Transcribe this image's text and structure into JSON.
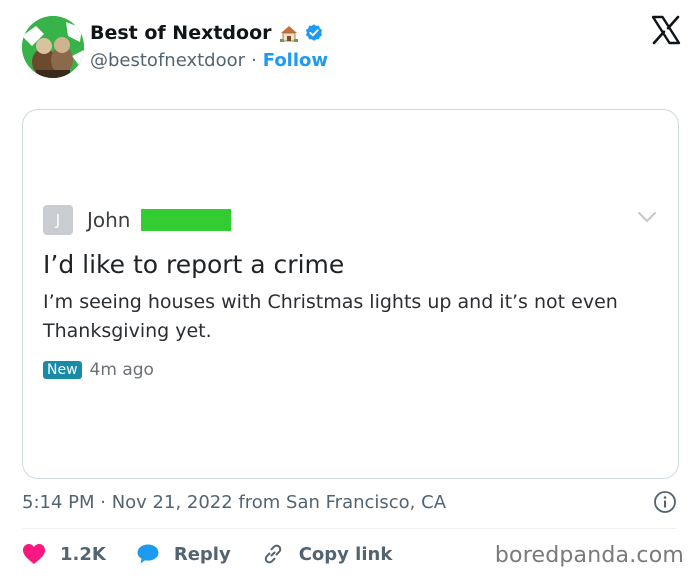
{
  "tweet": {
    "display_name": "Best of Nextdoor",
    "handle": "@bestofnextdoor",
    "separator": "·",
    "follow_label": "Follow",
    "timestamp": "5:14 PM · Nov 21, 2022 from San Francisco, CA",
    "likes_count": "1.2K",
    "reply_label": "Reply",
    "copy_link_label": "Copy link"
  },
  "embedded_post": {
    "avatar_initial": "J",
    "author": "John",
    "title": "I’d like to report a crime",
    "body": "I’m seeing houses with Christmas lights up and it’s not even Thanksgiving yet.",
    "badge": "New",
    "time_ago": "4m ago"
  },
  "watermark": "boredpanda.com",
  "colors": {
    "accent": "#1d9bf0",
    "like": "#f91880",
    "new_badge": "#178ba8",
    "redaction": "#33cc33"
  },
  "icons": [
    "house-emoji-icon",
    "verified-badge-icon",
    "x-logo-icon",
    "chevron-down-icon",
    "info-icon",
    "heart-icon",
    "reply-bubble-icon",
    "link-icon"
  ]
}
